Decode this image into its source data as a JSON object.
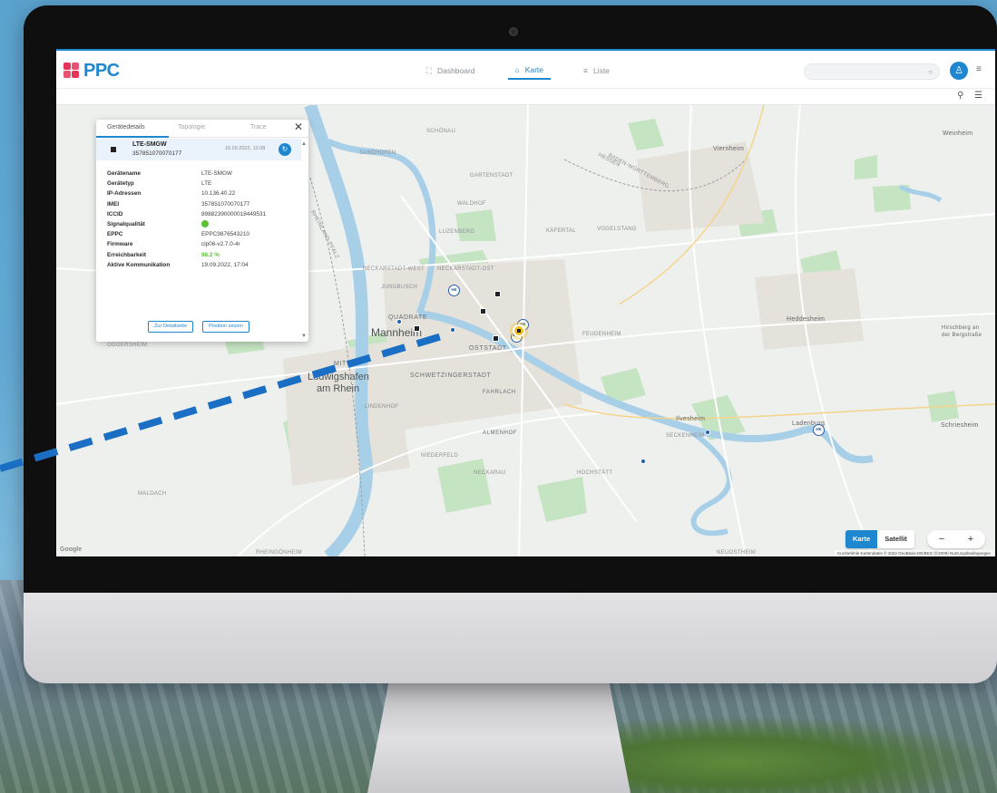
{
  "app": {
    "logo_text": "PPC",
    "nav": [
      {
        "label": "Dashboard",
        "icon": "dashboard-icon",
        "active": false
      },
      {
        "label": "Karte",
        "icon": "map-icon",
        "active": true
      },
      {
        "label": "Liste",
        "icon": "list-icon",
        "active": false
      }
    ],
    "search_placeholder": "",
    "accent": "#1f86d0"
  },
  "panel": {
    "tabs": [
      "Gerätedetails",
      "Topologie",
      "Trace"
    ],
    "active_tab": "Gerätedetails",
    "device": {
      "name": "LTE-SMGW",
      "id": "357851070070177",
      "date": "16.09.2022, 12:08"
    },
    "properties": [
      {
        "key": "Gerätename",
        "value": "LTE-SMGW"
      },
      {
        "key": "Gerätetyp",
        "value": "LTE"
      },
      {
        "key": "IP-Adressen",
        "value": "10.136.40.22"
      },
      {
        "key": "IMEI",
        "value": "357851070070177"
      },
      {
        "key": "ICCID",
        "value": "89882390000018449531"
      },
      {
        "key": "Signalqualität",
        "value": ""
      },
      {
        "key": "EPPC",
        "value": "EPPC9876543210"
      },
      {
        "key": "Firmware",
        "value": "clp06-v2.7.0-4r"
      },
      {
        "key": "Erreichbarkeit",
        "value": "98.2 %"
      },
      {
        "key": "Aktive Kommunikation",
        "value": "19.09.2022, 17:04"
      }
    ],
    "signal_color": "#5bc236",
    "buttons": {
      "details": "Zur Detailseite",
      "position": "Position setzen"
    }
  },
  "map": {
    "cities": [
      "Mannheim",
      "Ludwigshafen",
      "am Rhein",
      "Viernheim",
      "Weinheim",
      "Heddesheim",
      "Ladenburg",
      "Schriesheim",
      "Ilvesheim",
      "Hirschberg an",
      "der Bergstraße"
    ],
    "districts": [
      "QUADRATE",
      "MITTE",
      "OSTSTADT",
      "SCHWETZINGERSTADT",
      "FAHRLACH",
      "NECKARSTADT-WEST",
      "ALMENHOF",
      "GARTENSTADT",
      "KÄFERTAL",
      "VOGELSTANG",
      "FEUDENHEIM",
      "SECKENHEIM",
      "NIEDERFELD",
      "NECKARAU",
      "HOCHSTÄTT",
      "MALDACH",
      "RHEINGÖNHEIM",
      "OGGERSHEIM",
      "SCHÖNAU",
      "SANDHOFEN",
      "LUZENBERG",
      "WALDHOF",
      "NECKARSTADT-OST",
      "JUNGBUSCH",
      "LINDENHOF",
      "NEUOSTHEIM"
    ],
    "state_border_labels": [
      "HESSEN",
      "BADEN-WÜRTTEMBERG",
      "RHEINLAND-PFALZ"
    ],
    "map_type": {
      "karte": "Karte",
      "satellit": "Satellit"
    },
    "zoom": {
      "out": "−",
      "in": "+"
    },
    "attribution": "Kurzbefehle   Kartendaten © 2022 GeoBasis-DE/BKG (©2009)   Nutzungsbedingungen",
    "google": "Google"
  }
}
